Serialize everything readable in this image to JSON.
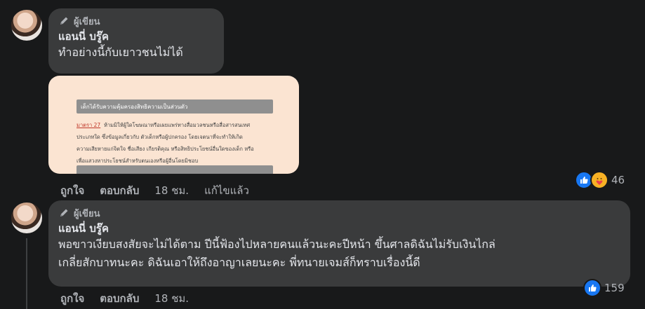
{
  "comment1": {
    "badge": "ผู้เขียน",
    "author": "แอนนี่ บรู๊ค",
    "text": "ทำอย่างนี้กับเยาวชนไม่ได้",
    "attachment": {
      "header": "เด็กได้รับความคุ้มครองสิทธิความเป็นส่วนตัว",
      "article": "มาตรา 27",
      "lines": [
        "ห้ามมิให้ผู้ใดโฆษณาหรือเผยแพร่ทางสื่อมวลชนหรือสื่อสารสนเทศ",
        "ประเภทใด ซึ่งข้อมูลเกี่ยวกับ ตัวเด็กหรือผู้ปกครอง โดยเจตนาที่จะทำให้เกิด",
        "ความเสียหายแก่จิตใจ ชื่อเสียง เกียรติคุณ หรือสิทธิประโยชน์อื่นใดของเด็ก หรือ",
        "เพื่อแสวงหาประโยชน์สำหรับตนเองหรือผู้อื่นโดยมิชอบ"
      ]
    },
    "actions": {
      "like": "ถูกใจ",
      "reply": "ตอบกลับ",
      "time": "18 ชม.",
      "edited": "แก้ไขแล้ว"
    },
    "reaction_count": "46",
    "colors": {
      "like": "#1877f2",
      "care": "#f7b125"
    }
  },
  "comment2": {
    "badge": "ผู้เขียน",
    "author": "แอนนี่ บรู๊ค",
    "text_line1": "พอขาวเงียบสงสัยจะไม่ได้ตาม ปีนี้ฟ้องไปหลายคนแล้วนะคะปีหน้า ขึ้นศาลดิฉันไม่รับเงินไกล่",
    "text_line2": "เกลี่ยสักบาทนะคะ ดิฉันเอาให้ถึงอาญาเลยนะคะ พี่ทนายเจมส์ก็ทราบเรื่องนี้ดี",
    "actions": {
      "like": "ถูกใจ",
      "reply": "ตอบกลับ",
      "time": "18 ชม."
    },
    "reaction_count": "159"
  }
}
